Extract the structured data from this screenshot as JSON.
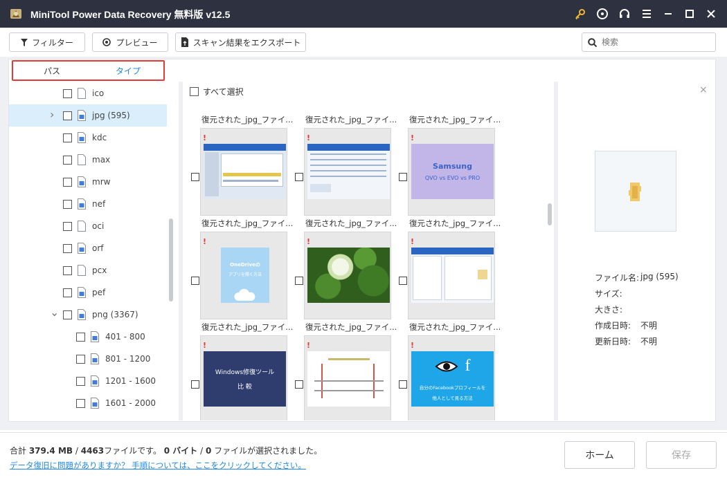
{
  "window": {
    "title": "MiniTool Power Data Recovery 無料版 v12.5"
  },
  "toolbar": {
    "filter_label": "フィルター",
    "preview_label": "プレビュー",
    "export_label": "スキャン結果をエクスポート",
    "search_placeholder": "検索"
  },
  "tabs": {
    "path_label": "パス",
    "type_label": "タイプ",
    "active": "type"
  },
  "tree": {
    "items": [
      {
        "label": "ico",
        "icon": "file-icon"
      },
      {
        "label": "jpg (595)",
        "icon": "image-file-icon",
        "selected": true,
        "expander": "collapsed"
      },
      {
        "label": "kdc",
        "icon": "image-file-icon"
      },
      {
        "label": "max",
        "icon": "file-icon"
      },
      {
        "label": "mrw",
        "icon": "image-file-icon"
      },
      {
        "label": "nef",
        "icon": "image-file-icon"
      },
      {
        "label": "oci",
        "icon": "file-icon"
      },
      {
        "label": "orf",
        "icon": "image-file-icon"
      },
      {
        "label": "pcx",
        "icon": "file-icon"
      },
      {
        "label": "pef",
        "icon": "image-file-icon"
      },
      {
        "label": "png (3367)",
        "icon": "image-file-icon",
        "expander": "expanded"
      },
      {
        "label": "401 - 800",
        "icon": "image-file-icon",
        "child": true
      },
      {
        "label": "801 - 1200",
        "icon": "image-file-icon",
        "child": true
      },
      {
        "label": "1201 - 1600",
        "icon": "image-file-icon",
        "child": true
      },
      {
        "label": "1601 - 2000",
        "icon": "image-file-icon",
        "child": true
      }
    ]
  },
  "grid": {
    "select_all_label": "すべて選択",
    "tiles": [
      {
        "label": "復元された_jpg_ファイ...",
        "thumb": "screenshot-blue"
      },
      {
        "label": "復元された_jpg_ファイ...",
        "thumb": "screenshot-table"
      },
      {
        "label": "復元された_jpg_ファイ...",
        "thumb": "samsung",
        "line1": "Samsung",
        "line2": "QVO vs EVO vs PRO"
      },
      {
        "label": "復元された_jpg_ファイ...",
        "thumb": "onedrive",
        "line1": "OneDriveの",
        "line2": "アプリを開く方法"
      },
      {
        "label": "復元された_jpg_ファイ...",
        "thumb": "clover"
      },
      {
        "label": "復元された_jpg_ファイ...",
        "thumb": "screenshot-explorer"
      },
      {
        "label": "復元された_jpg_ファイ...",
        "thumb": "windows",
        "line1": "Windows修復ツール",
        "line2": "比 較"
      },
      {
        "label": "復元された_jpg_ファイ...",
        "thumb": "diagram"
      },
      {
        "label": "復元された_jpg_ファイ...",
        "thumb": "facebook",
        "line1": "自分のFacebookプロフィールを",
        "line2": "他人として見る方法"
      }
    ]
  },
  "preview": {
    "close_label": "×",
    "fields": [
      {
        "label": "ファイル名:",
        "value": "jpg (595)"
      },
      {
        "label": "サイズ:",
        "value": ""
      },
      {
        "label": "大きさ:",
        "value": ""
      },
      {
        "label": "作成日時:",
        "value": "不明"
      },
      {
        "label": "更新日時:",
        "value": "不明"
      }
    ]
  },
  "footer": {
    "summary_prefix": "合計 ",
    "total_size": "379.4 MB",
    "slash1": " / ",
    "total_files": "4463",
    "summary_mid": "ファイルです。 ",
    "selected_size": "0 バイト",
    "slash2": " / ",
    "selected_files": "0",
    "summary_suffix": " ファイルが選択されました。",
    "help_text": "データ復旧に問題がありますか？ 手順については、ここをクリックしてください。",
    "home_label": "ホーム",
    "save_label": "保存"
  },
  "colors": {
    "titlebar": "#2e3240",
    "accent": "#1e88e5",
    "selection": "#dbeefb",
    "tab_highlight_border": "#e53935"
  }
}
